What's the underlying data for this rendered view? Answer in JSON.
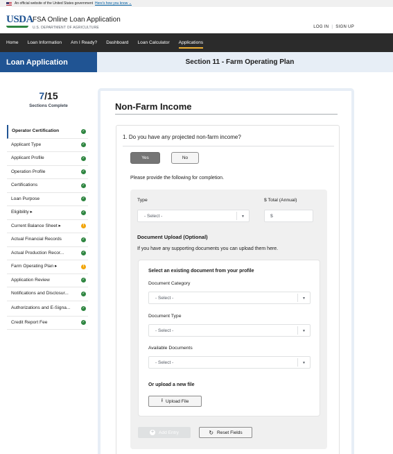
{
  "gov_banner": {
    "text": "An official website of the United States government",
    "link": "Here's how you know"
  },
  "header": {
    "logo": "USDA",
    "app_title": "FSA Online Loan Application",
    "department": "U.S. DEPARTMENT OF AGRICULTURE",
    "login": "LOG IN",
    "signup": "SIGN UP"
  },
  "nav": {
    "items": [
      {
        "label": "Home"
      },
      {
        "label": "Loan Information"
      },
      {
        "label": "Am I Ready?"
      },
      {
        "label": "Dashboard"
      },
      {
        "label": "Loan Calculator"
      },
      {
        "label": "Applications"
      }
    ],
    "active_index": 5
  },
  "subheader": {
    "left": "Loan Application",
    "right": "Section 11 - Farm Operating Plan"
  },
  "sidebar": {
    "progress_current": "7",
    "progress_total": "/15",
    "progress_label": "Sections Complete",
    "steps": [
      {
        "label": "Operator Certification",
        "status": "complete"
      },
      {
        "label": "Applicant Type",
        "status": "complete"
      },
      {
        "label": "Applicant Profile",
        "status": "complete"
      },
      {
        "label": "Operation Profile",
        "status": "complete"
      },
      {
        "label": "Certifications",
        "status": "complete"
      },
      {
        "label": "Loan Purpose",
        "status": "complete"
      },
      {
        "label": "Eligibility ▸",
        "status": "complete"
      },
      {
        "label": "Current Balance Sheet ▸",
        "status": "warning"
      },
      {
        "label": "Actual Financial Records",
        "status": "complete"
      },
      {
        "label": "Actual Production Recor...",
        "status": "complete"
      },
      {
        "label": "Farm Operating Plan ▸",
        "status": "warning"
      },
      {
        "label": "Application Review",
        "status": "complete"
      },
      {
        "label": "Notifications and Disclosur...",
        "status": "complete"
      },
      {
        "label": "Authorizations and E-Signa...",
        "status": "complete"
      },
      {
        "label": "Credit Report Fee",
        "status": "complete"
      }
    ],
    "colors": {
      "complete": "#2e8540",
      "warning": "#f2a60c"
    }
  },
  "main": {
    "title": "Non-Farm Income",
    "question": "1. Do you have any projected non-farm income?",
    "yes_label": "Yes",
    "no_label": "No",
    "selected_answer": "Yes",
    "provide_text": "Please provide the following for completion.",
    "type_label": "Type",
    "type_value": "- Select -",
    "total_label": "$ Total (Annual)",
    "total_placeholder": "$",
    "doc_upload_heading": "Document Upload (Optional)",
    "doc_upload_help": "If you have any supporting documents you can upload them here.",
    "existing_doc_heading": "Select an existing document from your profile",
    "doc_category_label": "Document Category",
    "doc_category_value": "- Select -",
    "doc_type_label": "Document Type",
    "doc_type_value": "- Select -",
    "available_docs_label": "Available Documents",
    "available_docs_value": "- Select -",
    "upload_new_heading": "Or upload a new file",
    "upload_button": "Upload File",
    "add_entry_button": "Add Entry",
    "reset_button": "Reset Fields"
  }
}
